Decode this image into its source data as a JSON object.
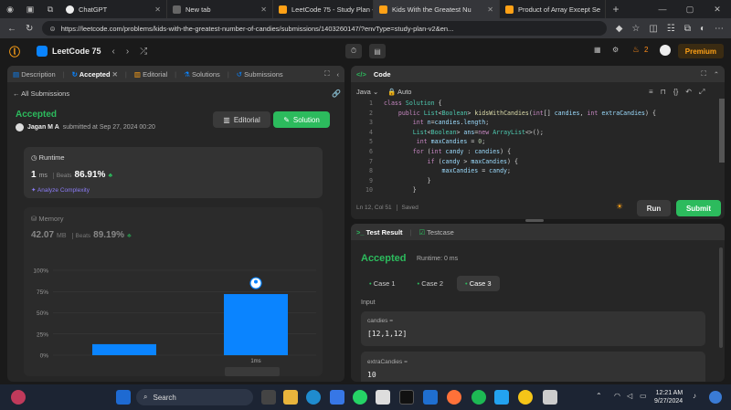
{
  "browser": {
    "tabs": [
      {
        "label": "ChatGPT",
        "active": false
      },
      {
        "label": "New tab",
        "active": false
      },
      {
        "label": "LeetCode 75 - Study Plan -",
        "active": false
      },
      {
        "label": "Kids With the Greatest Nu",
        "active": true
      },
      {
        "label": "Product of Array Except Se",
        "active": false
      }
    ],
    "url": "https://leetcode.com/problems/kids-with-the-greatest-number-of-candies/submissions/1403260147/?envType=study-plan-v2&en..."
  },
  "lc": {
    "title": "LeetCode 75",
    "streak": "2",
    "premium": "Premium"
  },
  "left": {
    "tabs": [
      "Description",
      "Accepted",
      "Editorial",
      "Solutions",
      "Submissions"
    ],
    "back": "All Submissions",
    "status": "Accepted",
    "user": "Jagan M A",
    "submitted": "submitted at Sep 27, 2024 00:20",
    "editorial_btn": "Editorial",
    "solution_btn": "Solution",
    "runtime": {
      "label": "Runtime",
      "value": "1",
      "unit": "ms",
      "beats_label": "Beats",
      "beats": "86.91%",
      "analyze": "Analyze Complexity"
    },
    "memory": {
      "label": "Memory",
      "value": "42.07",
      "unit": "MB",
      "beats_label": "Beats",
      "beats": "89.19%"
    }
  },
  "chart_data": {
    "type": "bar",
    "yticks": [
      "100%",
      "75%",
      "50%",
      "25%",
      "0%"
    ],
    "ylim": [
      0,
      100
    ],
    "bars": [
      {
        "label": "",
        "value": 13
      },
      {
        "label": "1ms",
        "value": 72
      }
    ],
    "color": "#0a84ff"
  },
  "code": {
    "header": "Code",
    "lang": "Java",
    "auto": "Auto",
    "lines": [
      {
        "n": "1",
        "t": "class Solution {"
      },
      {
        "n": "2",
        "t": "    public List<Boolean> kidsWithCandies(int[] candies, int extraCandies) {"
      },
      {
        "n": "3",
        "t": "        int n=candies.length;"
      },
      {
        "n": "4",
        "t": "        List<Boolean> ans=new ArrayList<>();"
      },
      {
        "n": "5",
        "t": "         int maxCandies = 0;"
      },
      {
        "n": "6",
        "t": "        for (int candy : candies) {"
      },
      {
        "n": "7",
        "t": "            if (candy > maxCandies) {"
      },
      {
        "n": "8",
        "t": "                maxCandies = candy;"
      },
      {
        "n": "9",
        "t": "            }"
      },
      {
        "n": "10",
        "t": "        }"
      }
    ],
    "cursor": "Ln 12, Col 51",
    "saved": "Saved",
    "run": "Run",
    "submit": "Submit"
  },
  "test": {
    "tab_result": "Test Result",
    "tab_case": "Testcase",
    "status": "Accepted",
    "runtime": "Runtime: 0 ms",
    "cases": [
      "Case 1",
      "Case 2",
      "Case 3"
    ],
    "input_label": "Input",
    "var1_name": "candies =",
    "var1_value": "[12,1,12]",
    "var2_name": "extraCandies =",
    "var2_value": "10"
  },
  "taskbar": {
    "search": "Search",
    "time": "12:21 AM",
    "date": "9/27/2024"
  }
}
